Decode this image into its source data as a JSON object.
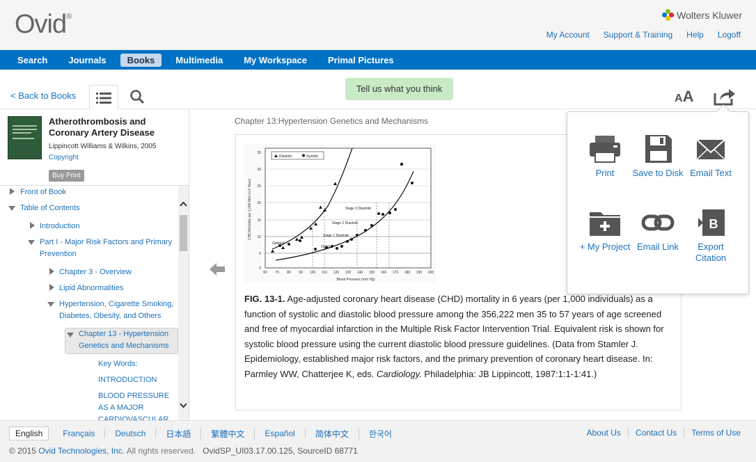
{
  "header": {
    "logo": "Ovid",
    "logo_reg": "®",
    "brand": "Wolters Kluwer",
    "links": [
      "My Account",
      "Support & Training",
      "Help",
      "Logoff"
    ]
  },
  "nav": {
    "items": [
      "Search",
      "Journals",
      "Books",
      "Multimedia",
      "My Workspace",
      "Primal Pictures"
    ],
    "active": "Books"
  },
  "toolbar": {
    "back": "< Back to Books",
    "feedback": "Tell us what you think",
    "font_label_small": "A",
    "font_label_big": "A"
  },
  "book": {
    "title": "Atherothrombosis and Coronary Artery Disease",
    "publisher": "Lippincott Williams & Wilkins, 2005",
    "copyright": "Copyright",
    "buy": "Buy Print"
  },
  "toc": {
    "items": [
      "Front of Book",
      "Table of Contents",
      "Introduction",
      "Part I - Major Risk Factors and Primary Prevention",
      "Chapter 3 - Overview",
      "Lipid Abnormalities",
      "Hypertension, Cigarette Smoking, Diabetes, Obesity, and Others",
      "Chapter 13 - Hypertension Genetics and Mechanisms",
      "Key Words:",
      "INTRODUCTION",
      "BLOOD PRESSURE AS A MAJOR CARDIOVASCULAR"
    ]
  },
  "main": {
    "breadcrumb": "Chapter 13:Hypertension Genetics and Mechanisms",
    "caption_label": "FIG. 13-1.",
    "caption_text": " Age-adjusted coronary heart disease (CHD) mortality in 6 years (per 1,000 individuals) as a function of systolic and diastolic blood pressure among the 356,222 men 35 to 57 years of age screened and free of myocardial infarction in the Multiple Risk Factor Intervention Trial. Equivalent risk is shown for systolic blood pressure using the current diastolic blood pressure guidelines. (Data from Stamler J. Epidemiology, established major risk factors, and the primary prevention of coronary heart disease. In: Parmley WW, Chatterjee K, eds. ",
    "caption_italic": "Cardiology.",
    "caption_end": " Philadelphia: JB Lippincott, 1987:1:1-1:41.)"
  },
  "figure": {
    "legend": [
      "Diastolic",
      "Systolic"
    ],
    "ylabel": "CHD Mortality per 1,000 Men in 6 Years",
    "xlabel": "Blood Pressure (mm Hg)",
    "yticks": [
      "0",
      "5",
      "10",
      "15",
      "20",
      "25",
      "30",
      "35"
    ],
    "xticks": [
      "60",
      "70",
      "80",
      "90",
      "100",
      "110",
      "120",
      "130",
      "140",
      "150",
      "160",
      "170",
      "180",
      "190",
      "200"
    ],
    "annotations": [
      "Stage 3 Diastolic",
      "Stage 2 Diastolic",
      "Stage 1 Diastolic",
      "Optimal",
      "Optimal"
    ]
  },
  "share": {
    "items": [
      "Print",
      "Save to Disk",
      "Email Text",
      "+ My Project",
      "Email Link",
      "Export Citation"
    ]
  },
  "footer": {
    "languages": [
      "English",
      "Français",
      "Deutsch",
      "日本語",
      "繁體中文",
      "Español",
      "简体中文",
      "한국어"
    ],
    "links": [
      "About Us",
      "Contact Us",
      "Terms of Use"
    ],
    "copyright_pre": "© 2015 ",
    "copyright_link": "Ovid Technologies, Inc.",
    "copyright_post": " All rights reserved.",
    "build": "OvidSP_UI03.17.00.125, SourceID 68771"
  }
}
